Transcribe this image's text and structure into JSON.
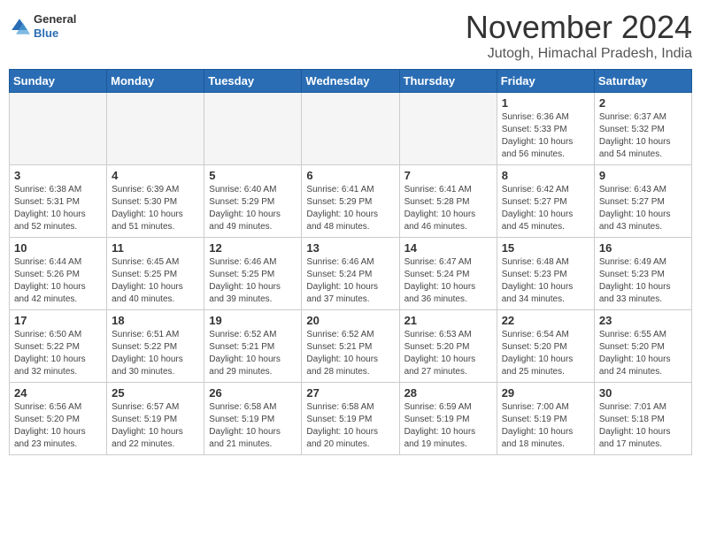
{
  "header": {
    "logo": {
      "general": "General",
      "blue": "Blue"
    },
    "title": "November 2024",
    "subtitle": "Jutogh, Himachal Pradesh, India"
  },
  "weekdays": [
    "Sunday",
    "Monday",
    "Tuesday",
    "Wednesday",
    "Thursday",
    "Friday",
    "Saturday"
  ],
  "weeks": [
    [
      {
        "day": "",
        "info": ""
      },
      {
        "day": "",
        "info": ""
      },
      {
        "day": "",
        "info": ""
      },
      {
        "day": "",
        "info": ""
      },
      {
        "day": "",
        "info": ""
      },
      {
        "day": "1",
        "info": "Sunrise: 6:36 AM\nSunset: 5:33 PM\nDaylight: 10 hours and 56 minutes."
      },
      {
        "day": "2",
        "info": "Sunrise: 6:37 AM\nSunset: 5:32 PM\nDaylight: 10 hours and 54 minutes."
      }
    ],
    [
      {
        "day": "3",
        "info": "Sunrise: 6:38 AM\nSunset: 5:31 PM\nDaylight: 10 hours and 52 minutes."
      },
      {
        "day": "4",
        "info": "Sunrise: 6:39 AM\nSunset: 5:30 PM\nDaylight: 10 hours and 51 minutes."
      },
      {
        "day": "5",
        "info": "Sunrise: 6:40 AM\nSunset: 5:29 PM\nDaylight: 10 hours and 49 minutes."
      },
      {
        "day": "6",
        "info": "Sunrise: 6:41 AM\nSunset: 5:29 PM\nDaylight: 10 hours and 48 minutes."
      },
      {
        "day": "7",
        "info": "Sunrise: 6:41 AM\nSunset: 5:28 PM\nDaylight: 10 hours and 46 minutes."
      },
      {
        "day": "8",
        "info": "Sunrise: 6:42 AM\nSunset: 5:27 PM\nDaylight: 10 hours and 45 minutes."
      },
      {
        "day": "9",
        "info": "Sunrise: 6:43 AM\nSunset: 5:27 PM\nDaylight: 10 hours and 43 minutes."
      }
    ],
    [
      {
        "day": "10",
        "info": "Sunrise: 6:44 AM\nSunset: 5:26 PM\nDaylight: 10 hours and 42 minutes."
      },
      {
        "day": "11",
        "info": "Sunrise: 6:45 AM\nSunset: 5:25 PM\nDaylight: 10 hours and 40 minutes."
      },
      {
        "day": "12",
        "info": "Sunrise: 6:46 AM\nSunset: 5:25 PM\nDaylight: 10 hours and 39 minutes."
      },
      {
        "day": "13",
        "info": "Sunrise: 6:46 AM\nSunset: 5:24 PM\nDaylight: 10 hours and 37 minutes."
      },
      {
        "day": "14",
        "info": "Sunrise: 6:47 AM\nSunset: 5:24 PM\nDaylight: 10 hours and 36 minutes."
      },
      {
        "day": "15",
        "info": "Sunrise: 6:48 AM\nSunset: 5:23 PM\nDaylight: 10 hours and 34 minutes."
      },
      {
        "day": "16",
        "info": "Sunrise: 6:49 AM\nSunset: 5:23 PM\nDaylight: 10 hours and 33 minutes."
      }
    ],
    [
      {
        "day": "17",
        "info": "Sunrise: 6:50 AM\nSunset: 5:22 PM\nDaylight: 10 hours and 32 minutes."
      },
      {
        "day": "18",
        "info": "Sunrise: 6:51 AM\nSunset: 5:22 PM\nDaylight: 10 hours and 30 minutes."
      },
      {
        "day": "19",
        "info": "Sunrise: 6:52 AM\nSunset: 5:21 PM\nDaylight: 10 hours and 29 minutes."
      },
      {
        "day": "20",
        "info": "Sunrise: 6:52 AM\nSunset: 5:21 PM\nDaylight: 10 hours and 28 minutes."
      },
      {
        "day": "21",
        "info": "Sunrise: 6:53 AM\nSunset: 5:20 PM\nDaylight: 10 hours and 27 minutes."
      },
      {
        "day": "22",
        "info": "Sunrise: 6:54 AM\nSunset: 5:20 PM\nDaylight: 10 hours and 25 minutes."
      },
      {
        "day": "23",
        "info": "Sunrise: 6:55 AM\nSunset: 5:20 PM\nDaylight: 10 hours and 24 minutes."
      }
    ],
    [
      {
        "day": "24",
        "info": "Sunrise: 6:56 AM\nSunset: 5:20 PM\nDaylight: 10 hours and 23 minutes."
      },
      {
        "day": "25",
        "info": "Sunrise: 6:57 AM\nSunset: 5:19 PM\nDaylight: 10 hours and 22 minutes."
      },
      {
        "day": "26",
        "info": "Sunrise: 6:58 AM\nSunset: 5:19 PM\nDaylight: 10 hours and 21 minutes."
      },
      {
        "day": "27",
        "info": "Sunrise: 6:58 AM\nSunset: 5:19 PM\nDaylight: 10 hours and 20 minutes."
      },
      {
        "day": "28",
        "info": "Sunrise: 6:59 AM\nSunset: 5:19 PM\nDaylight: 10 hours and 19 minutes."
      },
      {
        "day": "29",
        "info": "Sunrise: 7:00 AM\nSunset: 5:19 PM\nDaylight: 10 hours and 18 minutes."
      },
      {
        "day": "30",
        "info": "Sunrise: 7:01 AM\nSunset: 5:18 PM\nDaylight: 10 hours and 17 minutes."
      }
    ]
  ]
}
